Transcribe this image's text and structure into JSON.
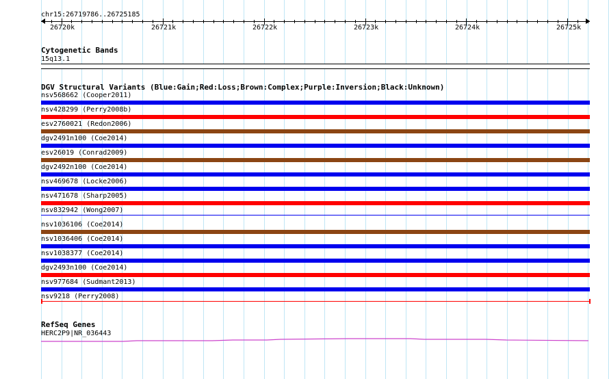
{
  "ruler": {
    "locus": "chr15:26719786..26725185",
    "ticks": [
      {
        "label": "26720k"
      },
      {
        "label": "26721k"
      },
      {
        "label": "26722k"
      },
      {
        "label": "26723k"
      },
      {
        "label": "26724k"
      },
      {
        "label": "26725k"
      }
    ]
  },
  "cytoband_track": {
    "title": "Cytogenetic Bands",
    "band": "15q13.1"
  },
  "dgv_track": {
    "title": "DGV Structural Variants (Blue:Gain;Red:Loss;Brown:Complex;Purple:Inversion;Black:Unknown)",
    "colors": {
      "gain": "#0000ee",
      "loss": "#ff0000",
      "complex": "#8b4513"
    },
    "variants": [
      {
        "label": "nsv568662 (Cooper2011)",
        "type": "gain"
      },
      {
        "label": "nsv428299 (Perry2008b)",
        "type": "loss"
      },
      {
        "label": "esv2760021 (Redon2006)",
        "type": "complex"
      },
      {
        "label": "dgv2491n100 (Coe2014)",
        "type": "gain"
      },
      {
        "label": "esv26019 (Conrad2009)",
        "type": "complex"
      },
      {
        "label": "dgv2492n100 (Coe2014)",
        "type": "gain"
      },
      {
        "label": "nsv469678 (Locke2006)",
        "type": "gain"
      },
      {
        "label": "nsv471678 (Sharp2005)",
        "type": "loss"
      },
      {
        "label": "nsv832942 (Wong2007)",
        "type": "gain-thin"
      },
      {
        "label": "nsv1036106 (Coe2014)",
        "type": "complex"
      },
      {
        "label": "nsv1036406 (Coe2014)",
        "type": "gain"
      },
      {
        "label": "nsv1038377 (Coe2014)",
        "type": "gain"
      },
      {
        "label": "dgv2493n100 (Coe2014)",
        "type": "loss"
      },
      {
        "label": "nsv977684 (Sudmant2013)",
        "type": "gain"
      },
      {
        "label": "nsv9218 (Perry2008)",
        "type": "loss-thin"
      }
    ]
  },
  "refseq_track": {
    "title": "RefSeq Genes",
    "gene": "HERC2P9|NR_036443",
    "color": "#cc44cc"
  }
}
